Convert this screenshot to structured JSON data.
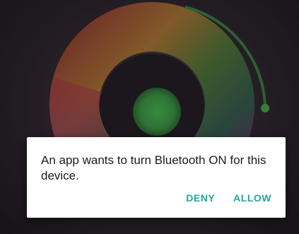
{
  "dialog": {
    "message": "An app wants to turn Bluetooth ON for this device.",
    "deny_label": "DENY",
    "allow_label": "ALLOW"
  },
  "colors": {
    "accent": "#26a69a",
    "dialog_background": "#ffffff",
    "message_text": "#1c1c1c"
  }
}
